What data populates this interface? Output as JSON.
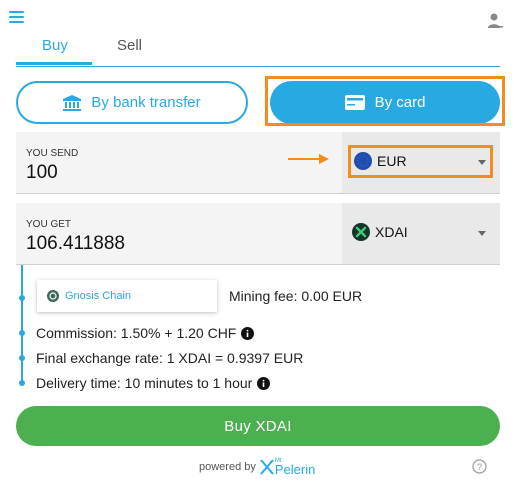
{
  "header": {
    "menu_icon": "hamburger-icon",
    "user_icon": "user-icon"
  },
  "tabs": [
    {
      "label": "Buy",
      "active": true
    },
    {
      "label": "Sell",
      "active": false
    }
  ],
  "payment_methods": {
    "bank": {
      "label": "By bank transfer",
      "icon": "bank-icon"
    },
    "card": {
      "label": "By card",
      "icon": "credit-card-icon",
      "selected": true
    }
  },
  "send": {
    "label": "YOU SEND",
    "amount": "100",
    "currency": "EUR",
    "currency_icon": "eu-flag-icon"
  },
  "get": {
    "label": "YOU GET",
    "amount": "106.411888",
    "currency": "XDAI",
    "currency_icon": "xdai-icon"
  },
  "details": {
    "network": "Gnosis Chain",
    "mining_fee": "Mining fee: 0.00 EUR",
    "commission": "Commission: 1.50% + 1.20 CHF",
    "exchange_rate": "Final exchange rate: 1 XDAI = 0.9397 EUR",
    "delivery_time": "Delivery time: 10 minutes to 1 hour"
  },
  "buy_button": {
    "label": "Buy XDAI"
  },
  "footer": {
    "powered_by": "powered by",
    "brand_small": "Mt",
    "brand": "Pelerin"
  },
  "colors": {
    "primary": "#29a9e1",
    "success": "#4caf50",
    "highlight": "#f28c1c"
  }
}
